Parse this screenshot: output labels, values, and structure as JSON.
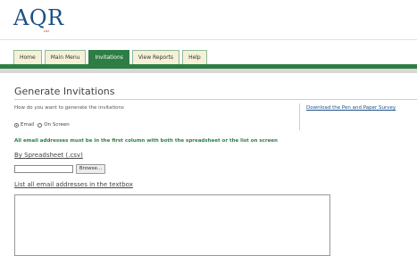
{
  "logo": {
    "text": "AQR",
    "suffix": "Ltd"
  },
  "nav": {
    "tabs": [
      {
        "label": "Home",
        "active": false
      },
      {
        "label": "Main Menu",
        "active": false
      },
      {
        "label": "Invitations",
        "active": true
      },
      {
        "label": "View Reports",
        "active": false
      },
      {
        "label": "Help",
        "active": false
      }
    ]
  },
  "page": {
    "title": "Generate Invitations",
    "question": "How do you want to generate the invitations",
    "download_link": "Download the Pen and Paper Survey",
    "radio_options": [
      {
        "label": "Email",
        "checked": true
      },
      {
        "label": "On Screen",
        "checked": false
      }
    ],
    "warning": "All email addresses must be in the first column with both the spreadsheet or the list on screen",
    "spreadsheet_label": "By Spreadsheet (.csv)",
    "file_value": "",
    "browse_label": "Browse...",
    "textbox_label": "List all email addresses in the textbox",
    "textbox_value": ""
  },
  "colors": {
    "accent": "#2d7d44",
    "tab_bg": "#f4f1d6",
    "link": "#1d4f86"
  }
}
